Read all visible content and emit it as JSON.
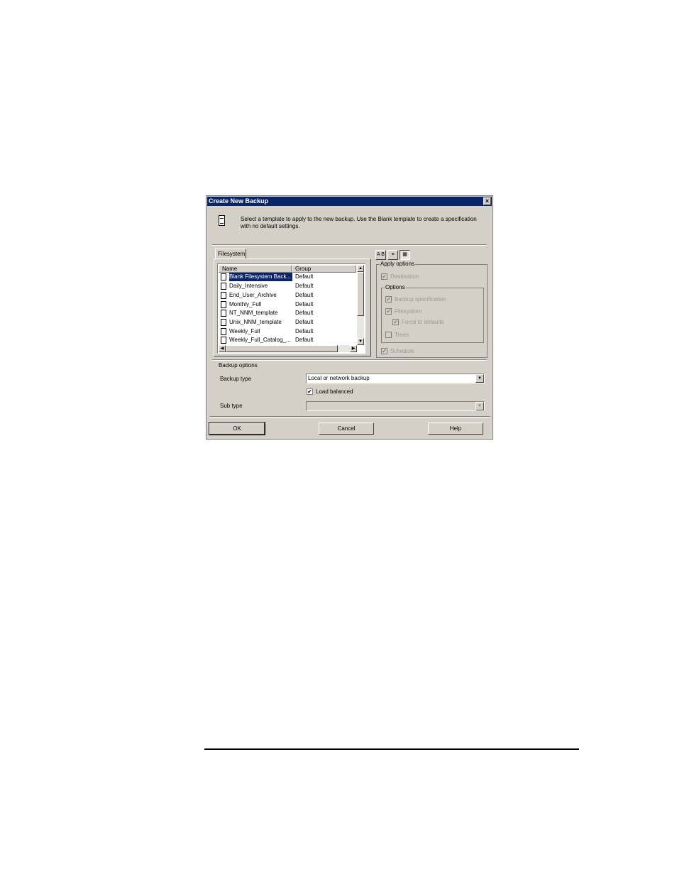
{
  "dialog": {
    "title": "Create New Backup",
    "close": "×",
    "description_line1": "Select a template to apply to the new backup. Use the Blank template to create a specification",
    "description_line2": "with no default settings."
  },
  "tab": {
    "label": "Filesystem"
  },
  "template_list": {
    "columns": [
      "Name",
      "Group"
    ],
    "rows": [
      {
        "name": "Blank Filesystem Back...",
        "group": "Default",
        "selected": true
      },
      {
        "name": "Daily_Intensive",
        "group": "Default"
      },
      {
        "name": "End_User_Archive",
        "group": "Default"
      },
      {
        "name": "Monthly_Full",
        "group": "Default"
      },
      {
        "name": "NT_NNM_template",
        "group": "Default"
      },
      {
        "name": "Unix_NNM_template",
        "group": "Default"
      },
      {
        "name": "Weekly_Full",
        "group": "Default"
      },
      {
        "name": "Weekly_Full_Catalog_...",
        "group": "Default"
      }
    ]
  },
  "view_buttons": [
    "A B",
    "≡",
    "▦"
  ],
  "apply_options": {
    "label": "Apply options",
    "destination": "Destination",
    "options_label": "Options",
    "backup_specification": "Backup specification",
    "filesystem": "Filesystem",
    "force_to_defaults": "Force to defaults",
    "trees": "Trees",
    "schedule": "Schedule"
  },
  "backup_options": {
    "label": "Backup options",
    "backup_type_label": "Backup type",
    "backup_type_value": "Local or network backup",
    "load_balanced_label": "Load balanced",
    "sub_type_label": "Sub type",
    "sub_type_value": ""
  },
  "buttons": {
    "ok": "OK",
    "cancel": "Cancel",
    "help": "Help"
  },
  "colors": {
    "title_bar": "#0a246a",
    "face": "#d4d0c8",
    "selection": "#0a246a"
  },
  "icons": {
    "checked": "✔"
  }
}
